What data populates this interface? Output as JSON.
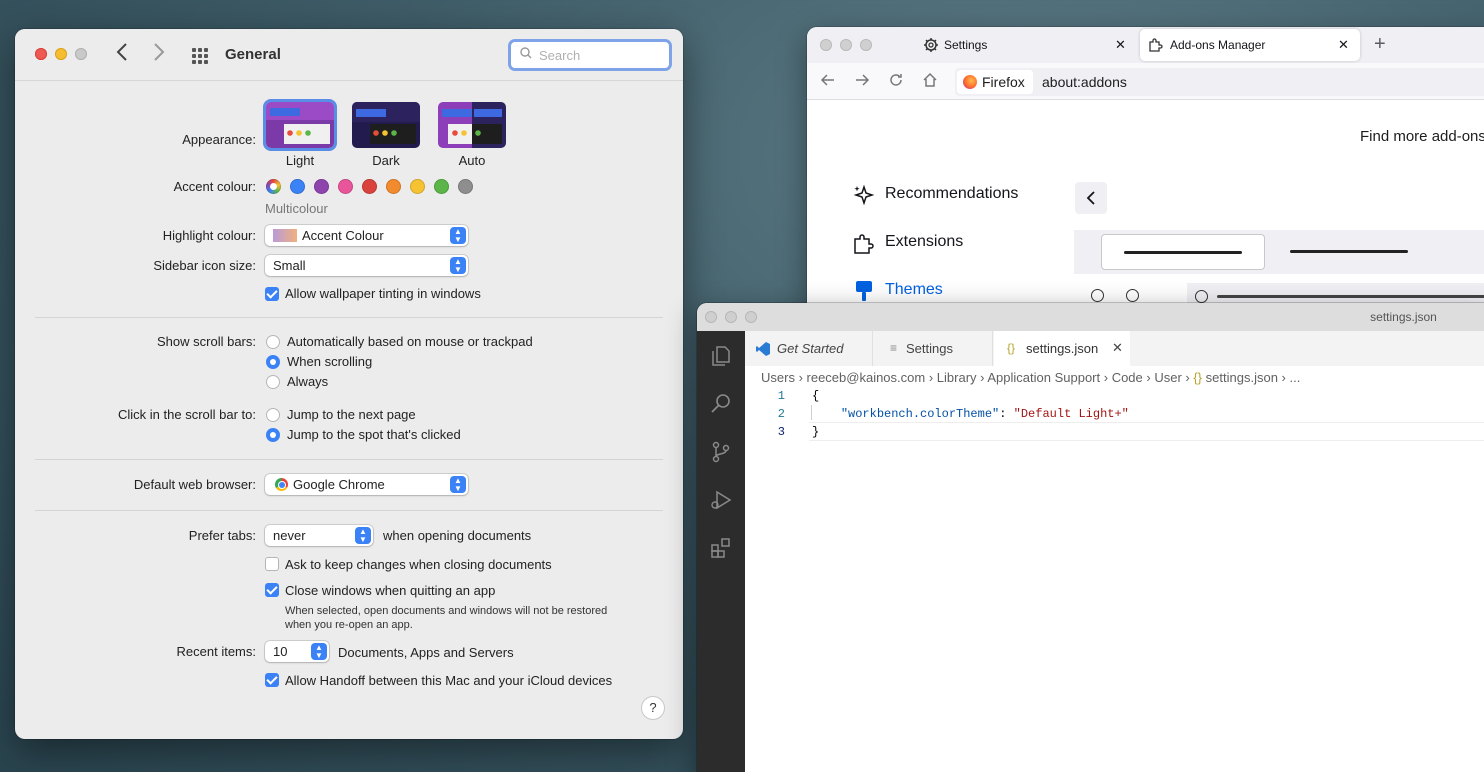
{
  "system_preferences": {
    "title": "General",
    "search_placeholder": "Search",
    "appearance": {
      "label": "Appearance:",
      "options": [
        "Light",
        "Dark",
        "Auto"
      ],
      "selected": "Light"
    },
    "accent_colour": {
      "label": "Accent colour:",
      "selected_name": "Multicolour",
      "swatches": [
        "#multicolour",
        "#3b82f6",
        "#8e44ad",
        "#e8559a",
        "#d9433b",
        "#f28a2e",
        "#f5c232",
        "#5bb548",
        "#8e8e8e"
      ]
    },
    "highlight_colour": {
      "label": "Highlight colour:",
      "value": "Accent Colour"
    },
    "sidebar_icon_size": {
      "label": "Sidebar icon size:",
      "value": "Small"
    },
    "allow_wallpaper_tinting": {
      "label": "Allow wallpaper tinting in windows",
      "checked": true
    },
    "show_scroll_bars": {
      "label": "Show scroll bars:",
      "options": [
        "Automatically based on mouse or trackpad",
        "When scrolling",
        "Always"
      ],
      "selected": "When scrolling"
    },
    "click_scroll_bar": {
      "label": "Click in the scroll bar to:",
      "options": [
        "Jump to the next page",
        "Jump to the spot that's clicked"
      ],
      "selected": "Jump to the spot that's clicked"
    },
    "default_browser": {
      "label": "Default web browser:",
      "value": "Google Chrome"
    },
    "prefer_tabs": {
      "label": "Prefer tabs:",
      "value": "never",
      "suffix": "when opening documents"
    },
    "ask_keep_changes": {
      "label": "Ask to keep changes when closing documents",
      "checked": false
    },
    "close_windows": {
      "label": "Close windows when quitting an app",
      "checked": true,
      "note_line1": "When selected, open documents and windows will not be restored",
      "note_line2": "when you re-open an app."
    },
    "recent_items": {
      "label": "Recent items:",
      "value": "10",
      "suffix": "Documents, Apps and Servers"
    },
    "allow_handoff": {
      "label": "Allow Handoff between this Mac and your iCloud devices",
      "checked": true
    },
    "help_label": "?"
  },
  "firefox": {
    "tabs": [
      {
        "label": "Settings",
        "icon": "gear-icon",
        "active": false
      },
      {
        "label": "Add-ons Manager",
        "icon": "puzzle-icon",
        "active": true
      }
    ],
    "new_tab_label": "+",
    "close_label": "✕",
    "identity_label": "Firefox",
    "url": "about:addons",
    "find_more": "Find more add-ons",
    "sidebar": [
      {
        "label": "Recommendations",
        "icon": "sparkle-icon"
      },
      {
        "label": "Extensions",
        "icon": "puzzle-icon"
      },
      {
        "label": "Themes",
        "icon": "brush-icon",
        "active": true
      }
    ],
    "back_label": "‹"
  },
  "vscode": {
    "window_title": "settings.json",
    "tabs": [
      {
        "label": "Get Started",
        "italic": true
      },
      {
        "label": "Settings"
      },
      {
        "label": "settings.json",
        "active": true
      }
    ],
    "breadcrumb": [
      "Users",
      "reeceb@kainos.com",
      "Library",
      "Application Support",
      "Code",
      "User",
      "settings.json",
      "..."
    ],
    "lines": [
      {
        "n": "1",
        "text": "{"
      },
      {
        "n": "2",
        "key": "\"workbench.colorTheme\"",
        "sep": ": ",
        "value": "\"Default Light+\""
      },
      {
        "n": "3",
        "text": "}"
      }
    ]
  },
  "colors": {
    "accent": "#3b82f6",
    "vscode_activity": "#2c2c2c",
    "firefox_link": "#0061e0"
  }
}
